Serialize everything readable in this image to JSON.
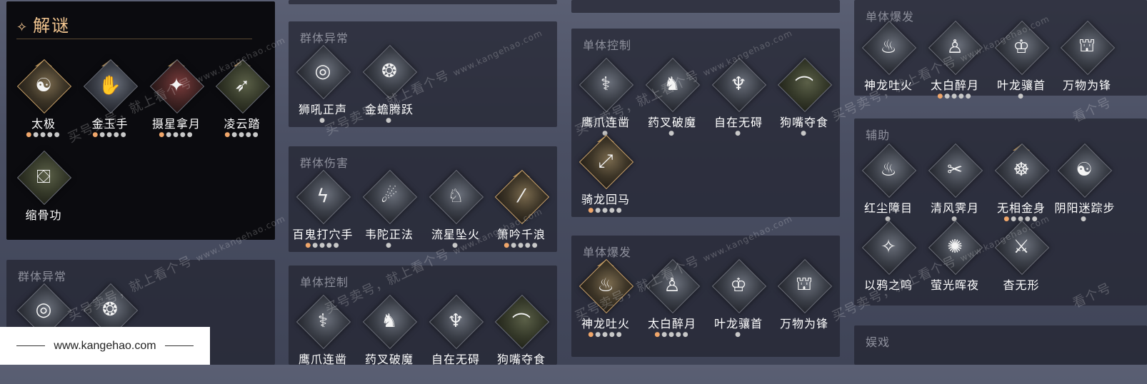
{
  "puzzle_panel": {
    "title": "解谜",
    "skills": [
      {
        "name": "太极",
        "dots": "●●●●●",
        "lit": 1
      },
      {
        "name": "金玉手",
        "dots": "●●●●●",
        "lit": 1
      },
      {
        "name": "摄星拿月",
        "dots": "●●●●●",
        "lit": 1
      },
      {
        "name": "凌云踏",
        "dots": "●●●●●",
        "lit": 1
      },
      {
        "name": "缩骨功",
        "dots": "",
        "lit": 0
      }
    ]
  },
  "col1_lower": {
    "title": "群体异常"
  },
  "col2": {
    "group_abnormal": {
      "title": "群体异常",
      "skills": [
        {
          "name": "狮吼正声",
          "dots": "●"
        },
        {
          "name": "金蟾腾跃",
          "dots": "●"
        }
      ]
    },
    "group_damage": {
      "title": "群体伤害",
      "skills": [
        {
          "name": "百鬼打穴手",
          "dots": "●●●●●"
        },
        {
          "name": "韦陀正法",
          "dots": "●"
        },
        {
          "name": "流星坠火",
          "dots": "●"
        },
        {
          "name": "箫吟千浪",
          "dots": "●●●●●"
        }
      ]
    },
    "single_control": {
      "title": "单体控制",
      "skills": [
        {
          "name": "鹰爪连凿"
        },
        {
          "name": "药叉破魔"
        },
        {
          "name": "自在无碍"
        },
        {
          "name": "狗嘴夺食"
        }
      ]
    }
  },
  "col3": {
    "single_control": {
      "title": "单体控制",
      "skills": [
        {
          "name": "鹰爪连凿",
          "dots": "●"
        },
        {
          "name": "药叉破魔",
          "dots": "●"
        },
        {
          "name": "自在无碍",
          "dots": "●"
        },
        {
          "name": "狗嘴夺食",
          "dots": "●"
        },
        {
          "name": "骑龙回马",
          "dots": "●●●●●"
        }
      ]
    },
    "single_burst": {
      "title": "单体爆发",
      "skills": [
        {
          "name": "神龙吐火",
          "dots": "●●●●●"
        },
        {
          "name": "太白醉月",
          "dots": "●●●●●"
        },
        {
          "name": "叶龙骧首",
          "dots": "●"
        },
        {
          "name": "万物为锋",
          "dots": ""
        }
      ]
    }
  },
  "col4": {
    "single_burst": {
      "title": "单体爆发",
      "skills": [
        {
          "name": "神龙吐火",
          "dots": ""
        },
        {
          "name": "太白醉月",
          "dots": "●●●●●"
        },
        {
          "name": "叶龙骧首",
          "dots": "●"
        },
        {
          "name": "万物为锋",
          "dots": ""
        }
      ]
    },
    "support": {
      "title": "辅助",
      "skills": [
        {
          "name": "红尘障目",
          "dots": "●"
        },
        {
          "name": "清风霁月",
          "dots": "●"
        },
        {
          "name": "无相金身",
          "dots": "●●●●●"
        },
        {
          "name": "阴阳迷踪步",
          "dots": "●"
        },
        {
          "name": "以鸦之鸣",
          "dots": ""
        },
        {
          "name": "萤光晖夜",
          "dots": ""
        },
        {
          "name": "杳无形",
          "dots": ""
        }
      ]
    },
    "entertainment": {
      "title": "娱戏"
    }
  },
  "watermark": {
    "text": "买号卖号，就上看个号",
    "url": "www.kangehao.com",
    "brand": "看个号"
  },
  "footer": {
    "url": "www.kangehao.com"
  },
  "colors": {
    "gold": "#f3c690",
    "panel_dark": "#0b0b0f",
    "dot_lit": "#f0a66a"
  },
  "icons": [
    "diamond-skill-icon",
    "crown-icon",
    "star-icon"
  ]
}
